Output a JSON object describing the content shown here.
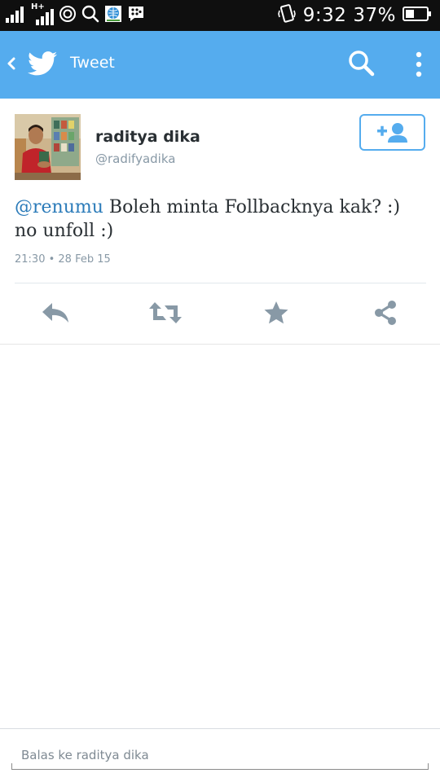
{
  "status_bar": {
    "time": "9:32",
    "battery_percent": "37%",
    "network_label": "H+",
    "icons": [
      "signal-icon",
      "signal-hplus-icon",
      "circle-icon",
      "search-notification-icon",
      "globe-app-icon",
      "blackberry-messenger-icon",
      "vibrate-icon",
      "battery-icon"
    ]
  },
  "app_bar": {
    "title": "Tweet",
    "icons": [
      "back-chevron-icon",
      "twitter-bird-icon",
      "search-icon",
      "overflow-menu-icon"
    ],
    "color": "#55acee"
  },
  "tweet": {
    "display_name": "raditya dika",
    "screen_name": "@radifyadika",
    "mention": "@renumu",
    "text": " Boleh minta Follbacknya kak? :) no unfoll :)",
    "timestamp": "21:30 • 28 Feb 15",
    "follow_icon": "add-user-icon",
    "actions": [
      {
        "name": "reply",
        "icon": "reply-icon"
      },
      {
        "name": "retweet",
        "icon": "retweet-icon"
      },
      {
        "name": "favorite",
        "icon": "star-icon"
      },
      {
        "name": "share",
        "icon": "share-icon"
      }
    ]
  },
  "reply": {
    "placeholder": "Balas ke raditya dika"
  },
  "colors": {
    "accent": "#55acee",
    "mention": "#2b7bb9",
    "action_icon": "#8899a6",
    "text": "#292f33"
  }
}
